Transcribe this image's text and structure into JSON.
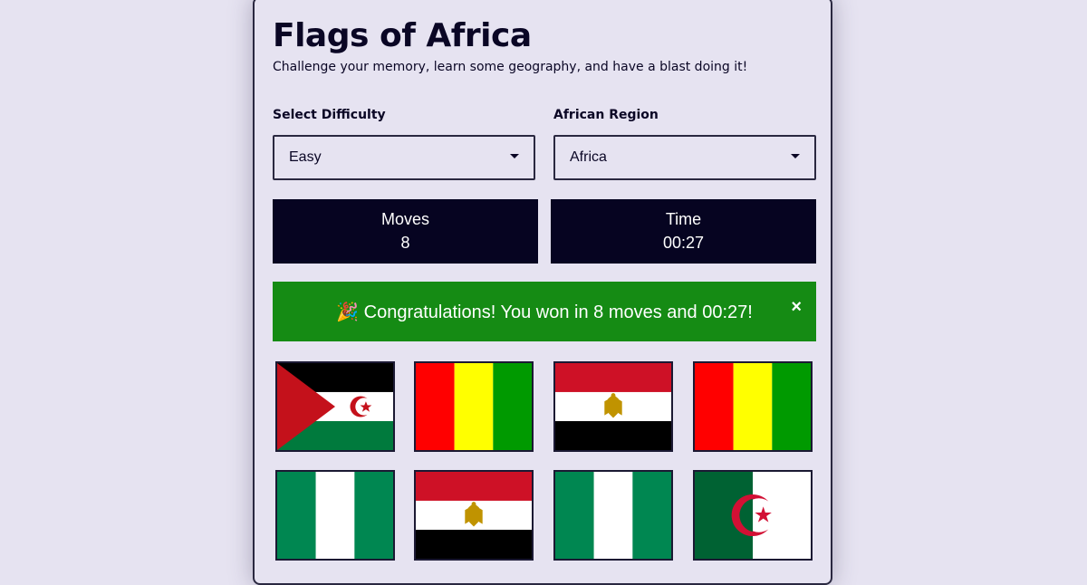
{
  "header": {
    "title": "Flags of Africa",
    "subtitle": "Challenge your memory, learn some geography, and have a blast doing it!"
  },
  "controls": {
    "difficulty": {
      "label": "Select Difficulty",
      "value": "Easy"
    },
    "region": {
      "label": "African Region",
      "value": "Africa"
    }
  },
  "stats": {
    "moves": {
      "label": "Moves",
      "value": "8"
    },
    "time": {
      "label": "Time",
      "value": "00:27"
    }
  },
  "banner": {
    "icon": "party-popper",
    "message": "Congratulations! You won in 8 moves and 00:27!",
    "close": "×",
    "color": "#158b14"
  },
  "cards": [
    {
      "flag": "western-sahara"
    },
    {
      "flag": "guinea"
    },
    {
      "flag": "egypt"
    },
    {
      "flag": "guinea"
    },
    {
      "flag": "nigeria"
    },
    {
      "flag": "egypt"
    },
    {
      "flag": "nigeria"
    },
    {
      "flag": "algeria"
    }
  ],
  "colors": {
    "background": "#e6e3f1",
    "dark": "#060421",
    "success": "#158b14"
  }
}
